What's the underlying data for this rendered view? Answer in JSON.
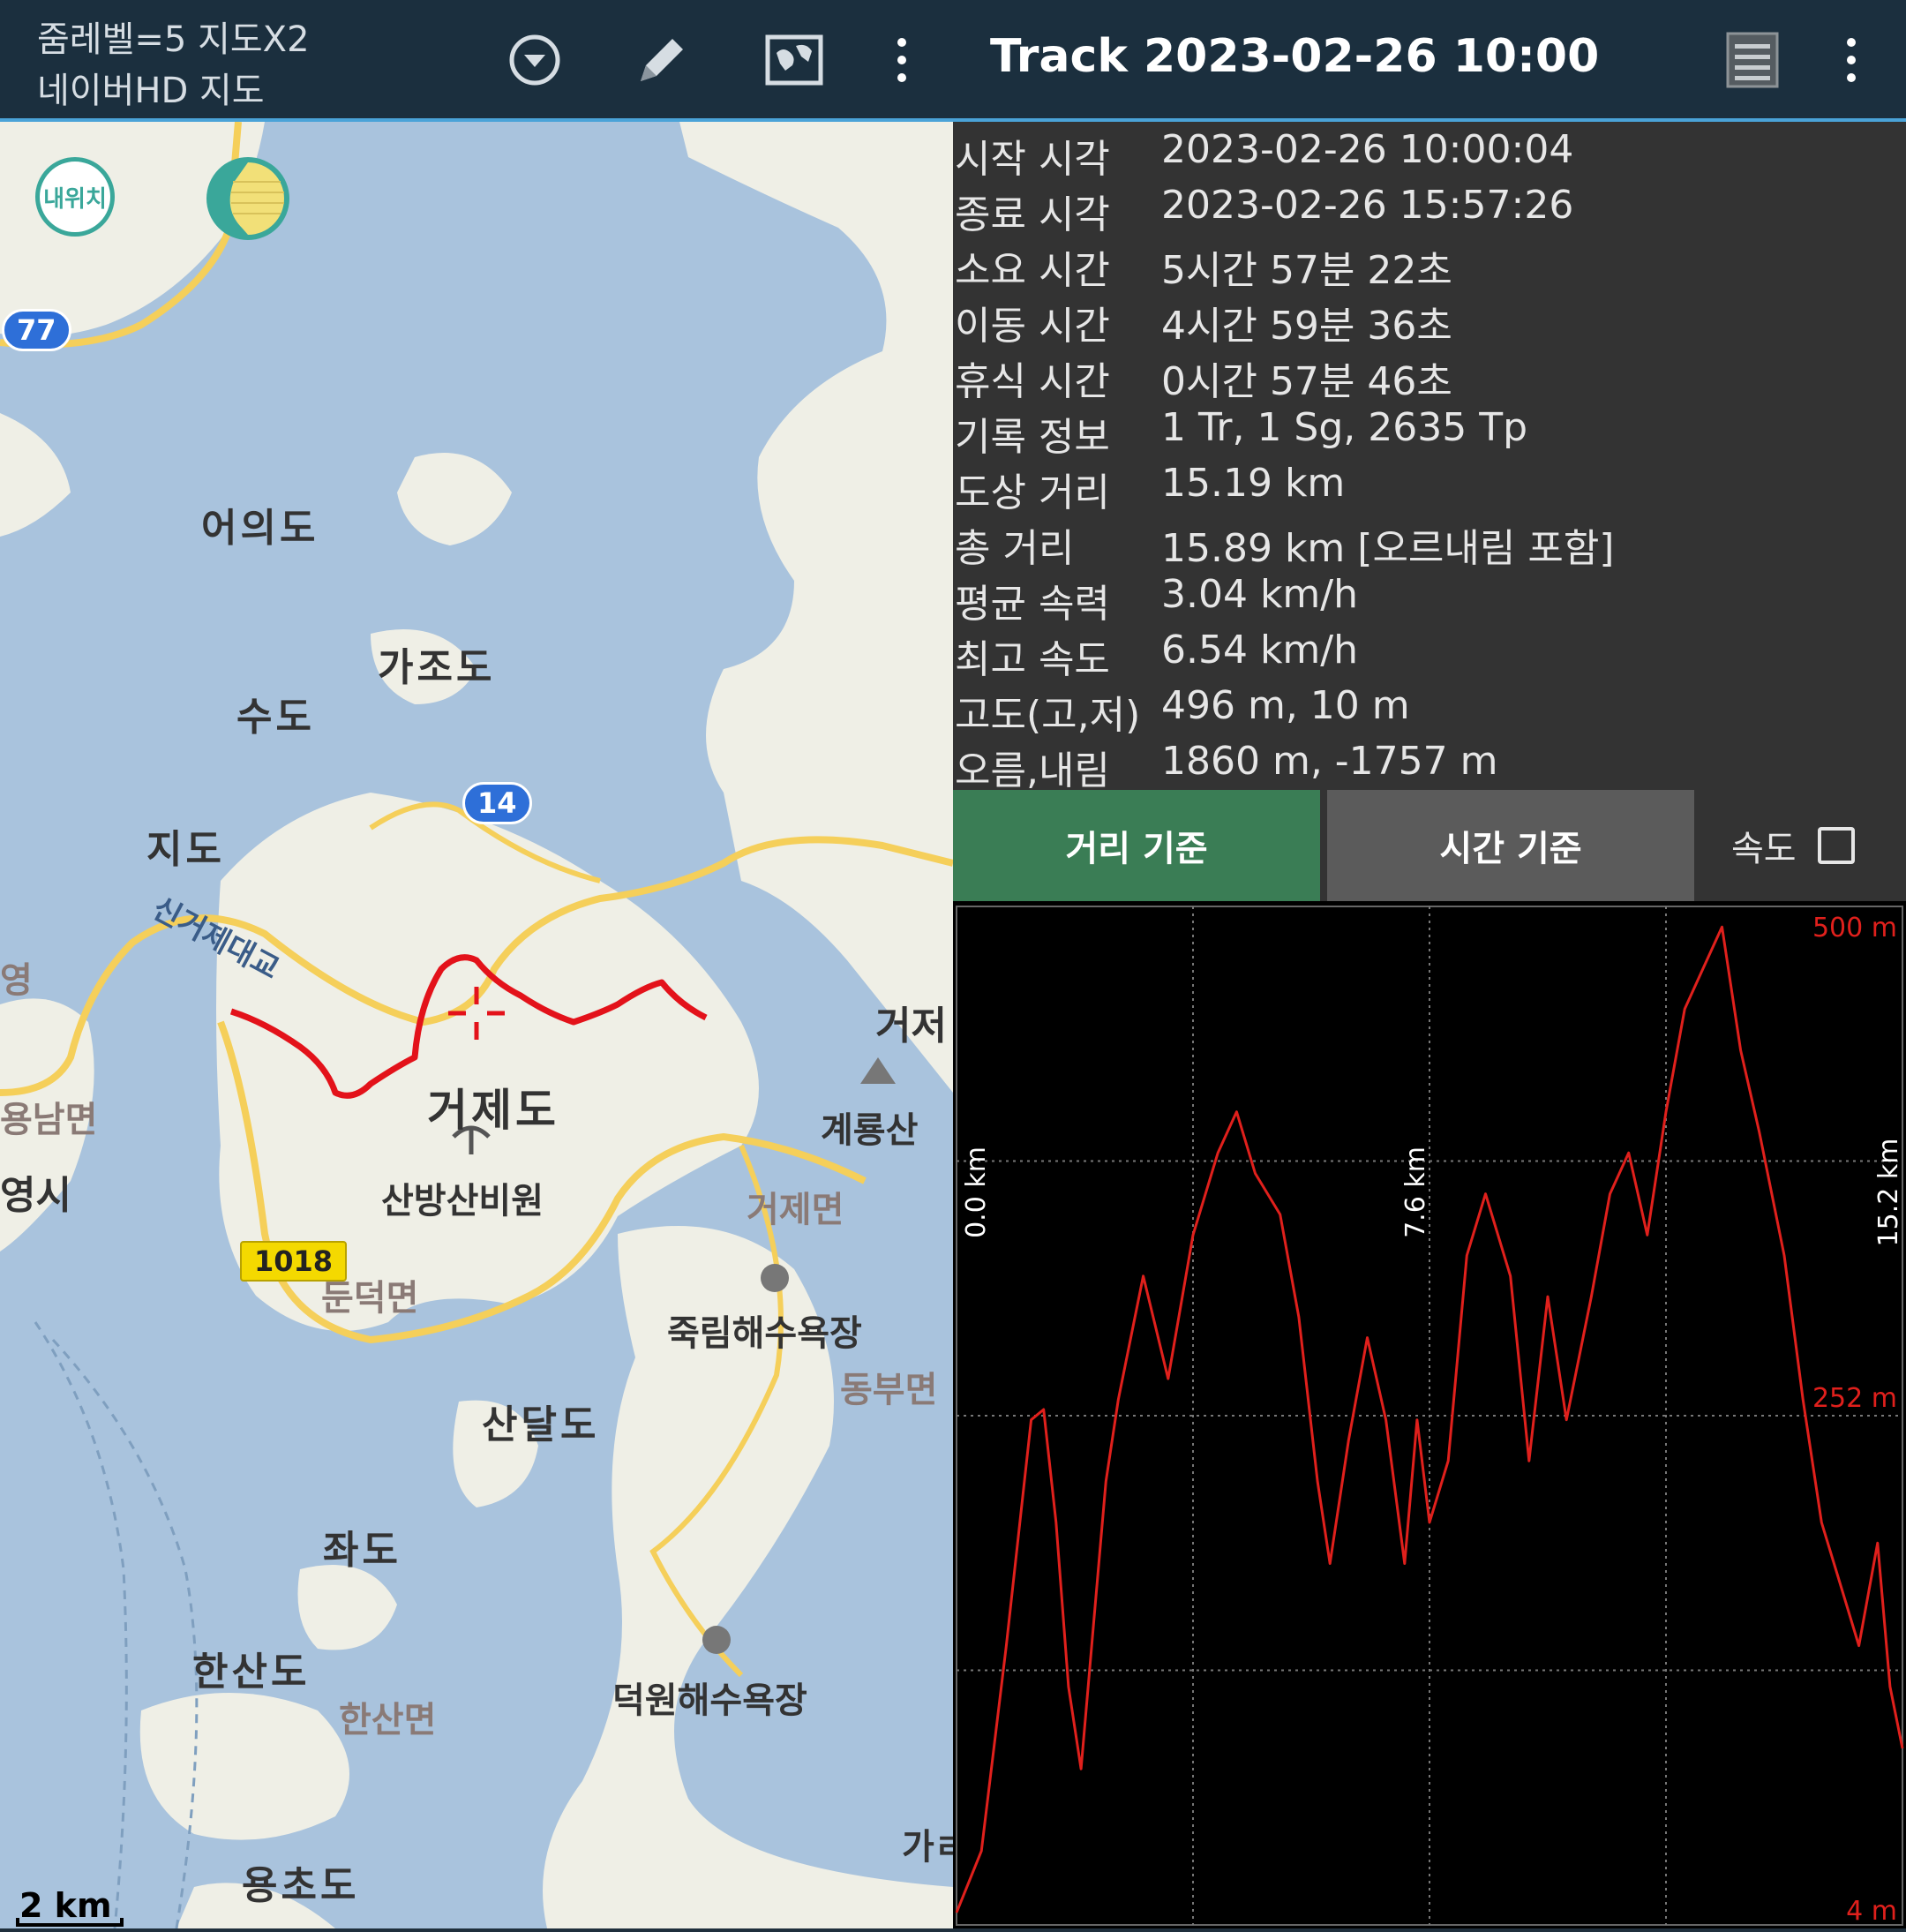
{
  "map_bar": {
    "status_line1": "줌레벨=5 지도X2",
    "status_line2": "네이버HD 지도",
    "icons": [
      "dropdown-icon",
      "pencil-icon",
      "map-icon",
      "more-vert-icon"
    ]
  },
  "track_bar": {
    "title": "Track 2023-02-26 10:00",
    "icons": [
      "list-icon",
      "more-vert-icon"
    ]
  },
  "map": {
    "my_location_label": "내위치",
    "scale_label": "2 km",
    "roads": [
      "77",
      "14",
      "1018"
    ],
    "labels": {
      "eouido": "어의도",
      "gajodo": "가조도",
      "sudo": "수도",
      "jido": "지도",
      "bridge": "신거제대교",
      "geojedo": "거제도",
      "sanbangsan": "산방산비원",
      "gyeryongsan": "계룡산",
      "geoje_myeon": "거제면",
      "dundeok_myeon": "둔덕면",
      "jukrim_beach": "죽림해수욕장",
      "dongbu_myeon": "동부면",
      "sandaldo": "산달도",
      "jwado": "좌도",
      "hansando": "한산도",
      "hansan_myeon": "한산면",
      "deokwon_beach": "덕원해수욕장",
      "yongchodo": "용초도",
      "yongnam_myeon": "용남면",
      "tongyeong_si": "영시",
      "young": "영",
      "geoje_partial": "거저",
      "gara_partial": "가ㄹ"
    }
  },
  "info": [
    {
      "key": "시작 시각",
      "value": "2023-02-26 10:00:04"
    },
    {
      "key": "종료 시각",
      "value": "2023-02-26 15:57:26"
    },
    {
      "key": "소요 시간",
      "value": "5시간 57분 22초"
    },
    {
      "key": "이동 시간",
      "value": "4시간 59분 36초"
    },
    {
      "key": "휴식 시간",
      "value": "0시간 57분 46초"
    },
    {
      "key": "기록 정보",
      "value": "1 Tr, 1 Sg, 2635 Tp"
    },
    {
      "key": "도상 거리",
      "value": "15.19 km"
    },
    {
      "key": "총 거리",
      "value": "15.89 km [오르내림 포함]"
    },
    {
      "key": "평균 속력",
      "value": "3.04 km/h"
    },
    {
      "key": "최고 속도",
      "value": "6.54 km/h"
    },
    {
      "key": "고도(고,저)",
      "value": "496 m, 10 m"
    },
    {
      "key": "오름,내림",
      "value": "1860 m, -1757 m"
    }
  ],
  "tabs": {
    "distance": "거리 기준",
    "time": "시간 기준",
    "speed": "속도",
    "speed_checked": false
  },
  "chart_data": {
    "type": "line",
    "x_unit": "km",
    "y_unit": "m",
    "xlim": [
      0.0,
      15.2
    ],
    "ylim": [
      4,
      500
    ],
    "x_ticks": [
      "0.0 km",
      "7.6 km",
      "15.2 km"
    ],
    "y_ticks": [
      "500 m",
      "252 m",
      "4 m"
    ],
    "line_color": "#e0201c",
    "grid": true,
    "series": [
      {
        "x": [
          0.0,
          0.4,
          0.8,
          1.2,
          1.4,
          1.6,
          1.8,
          2.0,
          2.2,
          2.4,
          2.6,
          3.0,
          3.4,
          3.8,
          4.2,
          4.5,
          4.8,
          5.2,
          5.5,
          5.8,
          6.0,
          6.3,
          6.6,
          6.9,
          7.2,
          7.4,
          7.6,
          7.9,
          8.2,
          8.5,
          8.9,
          9.2,
          9.5,
          9.8,
          10.2,
          10.5,
          10.8,
          11.1,
          11.4,
          11.7,
          12.0,
          12.3,
          12.6,
          12.9,
          13.3,
          13.6,
          13.9,
          14.2,
          14.5,
          14.8,
          15.0,
          15.2
        ],
        "y": [
          10,
          40,
          140,
          250,
          255,
          200,
          120,
          80,
          150,
          220,
          260,
          320,
          270,
          340,
          380,
          400,
          370,
          350,
          300,
          220,
          180,
          240,
          290,
          250,
          180,
          250,
          200,
          230,
          330,
          360,
          320,
          230,
          310,
          250,
          310,
          360,
          380,
          340,
          400,
          450,
          470,
          490,
          430,
          390,
          330,
          260,
          200,
          170,
          140,
          190,
          120,
          90
        ]
      }
    ]
  }
}
